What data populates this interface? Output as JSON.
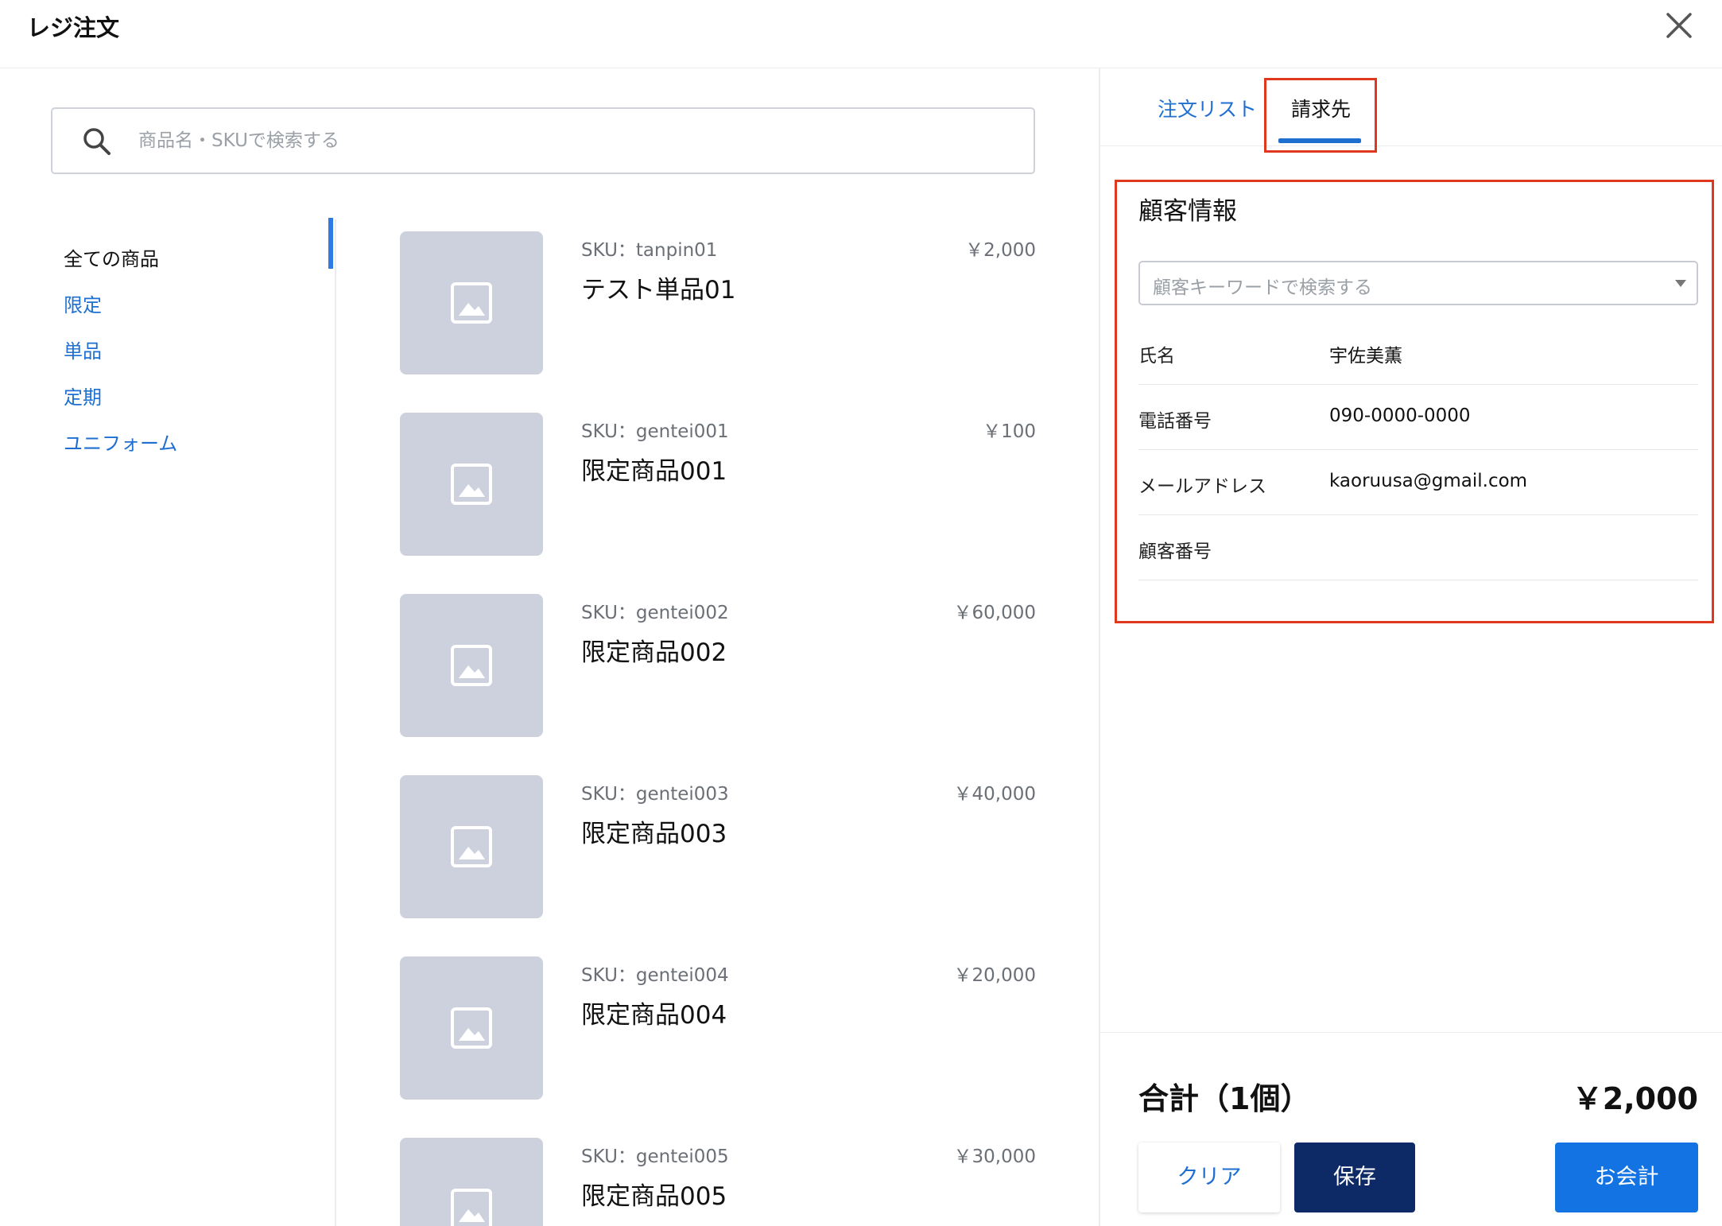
{
  "header": {
    "title": "レジ注文"
  },
  "search": {
    "placeholder": "商品名・SKUで検索する"
  },
  "categories": [
    {
      "label": "全ての商品",
      "active": true
    },
    {
      "label": "限定",
      "active": false
    },
    {
      "label": "単品",
      "active": false
    },
    {
      "label": "定期",
      "active": false
    },
    {
      "label": "ユニフォーム",
      "active": false
    }
  ],
  "products": [
    {
      "sku": "SKU：tanpin01",
      "name": "テスト単品01",
      "price": "￥2,000"
    },
    {
      "sku": "SKU：gentei001",
      "name": "限定商品001",
      "price": "￥100"
    },
    {
      "sku": "SKU：gentei002",
      "name": "限定商品002",
      "price": "￥60,000"
    },
    {
      "sku": "SKU：gentei003",
      "name": "限定商品003",
      "price": "￥40,000"
    },
    {
      "sku": "SKU：gentei004",
      "name": "限定商品004",
      "price": "￥20,000"
    },
    {
      "sku": "SKU：gentei005",
      "name": "限定商品005",
      "price": "￥30,000"
    }
  ],
  "tabs": [
    {
      "label": "注文リスト",
      "active": false
    },
    {
      "label": "請求先",
      "active": true
    }
  ],
  "customer": {
    "section_title": "顧客情報",
    "select_placeholder": "顧客キーワードで検索する",
    "fields": [
      {
        "label": "氏名",
        "value": "宇佐美薫"
      },
      {
        "label": "電話番号",
        "value": "090-0000-0000"
      },
      {
        "label": "メールアドレス",
        "value": "kaoruusa@gmail.com"
      },
      {
        "label": "顧客番号",
        "value": ""
      }
    ]
  },
  "summary": {
    "total_label": "合計（1個）",
    "total_value": "￥2,000"
  },
  "buttons": {
    "clear": "クリア",
    "save": "保存",
    "checkout": "お会計"
  },
  "colors": {
    "accent": "#1f6fd1",
    "save_button": "#0e2a66",
    "checkout_button": "#1373e3",
    "highlight": "#e0371f",
    "placeholder_image": "#cdd1dd"
  },
  "icons": {
    "close": "close-icon",
    "search": "search-icon",
    "image_placeholder": "image-icon",
    "dropdown": "caret-down-icon"
  }
}
